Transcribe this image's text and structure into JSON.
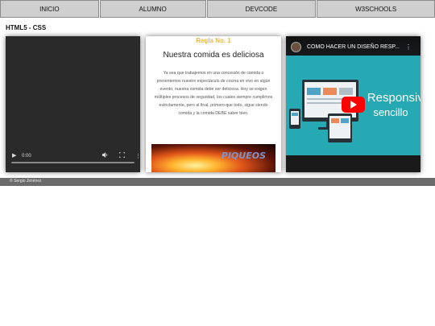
{
  "nav": {
    "items": [
      {
        "label": "INICIO"
      },
      {
        "label": "ALUMNO"
      },
      {
        "label": "DEVCODE"
      },
      {
        "label": "W3SCHOOLS"
      }
    ]
  },
  "page": {
    "title": "HTML5 - CSS"
  },
  "video": {
    "time": "0:00",
    "progress": 0
  },
  "article": {
    "rule": "Regla No. 1",
    "title": "Nuestra comida es deliciosa",
    "body": "Ya sea que trabajemos en una concesión de comida o presentemos nuestro espectáculo de cocina en vivo en algún evento, nuestra comida debe ser deliciosa. Hoy se exigen múltiples procesos de seguridad, los cuales siempre cumplimos estrictamente, pero al final, primero que todo, sigue siendo comida y la comida DEBE saber bien.",
    "image_text": "PIQUEOS"
  },
  "youtube": {
    "title": "COMO HACER UN DISEÑO RESP...",
    "thumb_line1": "Responsive",
    "thumb_line2": "sencillo",
    "accent": "#ff0000"
  },
  "footer": {
    "text": "© Sergio Jiménez"
  }
}
